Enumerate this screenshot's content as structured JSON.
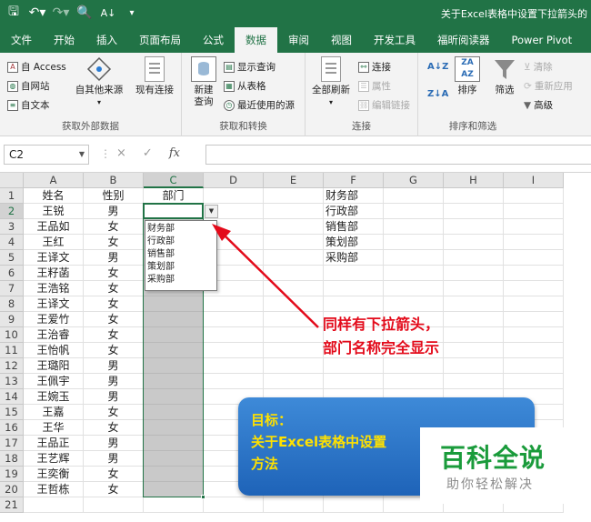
{
  "titlebar": {
    "title": "关于Excel表格中设置下拉箭头的",
    "qat": [
      {
        "icon": "save-icon",
        "glyph": "🖫"
      },
      {
        "icon": "undo-icon",
        "glyph": "↶▾"
      },
      {
        "icon": "redo-icon",
        "glyph": "↷▾"
      },
      {
        "icon": "print-preview-icon",
        "glyph": "🔍"
      },
      {
        "icon": "sort-icon",
        "glyph": "A↓"
      },
      {
        "icon": "customize-icon",
        "glyph": "▾"
      }
    ]
  },
  "tabs": [
    "文件",
    "开始",
    "插入",
    "页面布局",
    "公式",
    "数据",
    "审阅",
    "视图",
    "开发工具",
    "福昕阅读器",
    "Power Pivot"
  ],
  "active_tab": "数据",
  "ribbon": {
    "ext_data": {
      "access": "自 Access",
      "web": "自网站",
      "text": "自文本",
      "other": "自其他来源",
      "existing": "现有连接",
      "label": "获取外部数据"
    },
    "transform": {
      "new_query": "新建",
      "new_query_2": "查询",
      "show_query": "显示查询",
      "from_table": "从表格",
      "recent": "最近使用的源",
      "label": "获取和转换"
    },
    "connections": {
      "refresh_all": "全部刷新",
      "connect": "连接",
      "props": "属性",
      "edit_links": "编辑链接",
      "label": "连接"
    },
    "sort_filter": {
      "sort": "排序",
      "filter": "筛选",
      "clear": "清除",
      "reapply": "重新应用",
      "advanced": "高级",
      "label": "排序和筛选"
    }
  },
  "formula_bar": {
    "name_box": "C2",
    "cancel": "×",
    "confirm": "✓",
    "fx": "fx",
    "value": ""
  },
  "sheet": {
    "columns": [
      "A",
      "B",
      "C",
      "D",
      "E",
      "F",
      "G",
      "H",
      "I"
    ],
    "rows": [
      "1",
      "2",
      "3",
      "4",
      "5",
      "6",
      "7",
      "8",
      "9",
      "10",
      "11",
      "12",
      "13",
      "14",
      "15",
      "16",
      "17",
      "18",
      "19",
      "20",
      "21"
    ],
    "header": {
      "name": "姓名",
      "gender": "性别",
      "dept": "部门"
    },
    "data": [
      [
        "王锐",
        "男"
      ],
      [
        "王品如",
        "女"
      ],
      [
        "王红",
        "女"
      ],
      [
        "王译文",
        "男"
      ],
      [
        "王籽菡",
        "女"
      ],
      [
        "王浩铭",
        "女"
      ],
      [
        "王译文",
        "女"
      ],
      [
        "王爱竹",
        "女"
      ],
      [
        "王治睿",
        "女"
      ],
      [
        "王怡帆",
        "女"
      ],
      [
        "王璐阳",
        "男"
      ],
      [
        "王佩宇",
        "男"
      ],
      [
        "王婉玉",
        "男"
      ],
      [
        "王嘉",
        "女"
      ],
      [
        "王华",
        "女"
      ],
      [
        "王品正",
        "男"
      ],
      [
        "王艺辉",
        "男"
      ],
      [
        "王奕衡",
        "女"
      ],
      [
        "王哲栋",
        "女"
      ]
    ],
    "departments": [
      "财务部",
      "行政部",
      "销售部",
      "策划部",
      "采购部"
    ],
    "dropdown_options": [
      "财务部",
      "行政部",
      "销售部",
      "策划部",
      "采购部"
    ]
  },
  "annotation": {
    "line1": "同样有下拉箭头，",
    "line2": "部门名称完全显示",
    "color": "#e30a1a"
  },
  "bubble": {
    "line1": "目标：",
    "line2": "关于Excel表格中设置",
    "line3": "方法"
  },
  "watermark": {
    "title": "百科全说",
    "subtitle": "助你轻松解决"
  },
  "colors": {
    "accent": "#217346",
    "selection_gray": "#c9c9c9",
    "bubble": "#2a74c9",
    "bubble_text": "#ffe100",
    "watermark": "#1a9b3b"
  }
}
